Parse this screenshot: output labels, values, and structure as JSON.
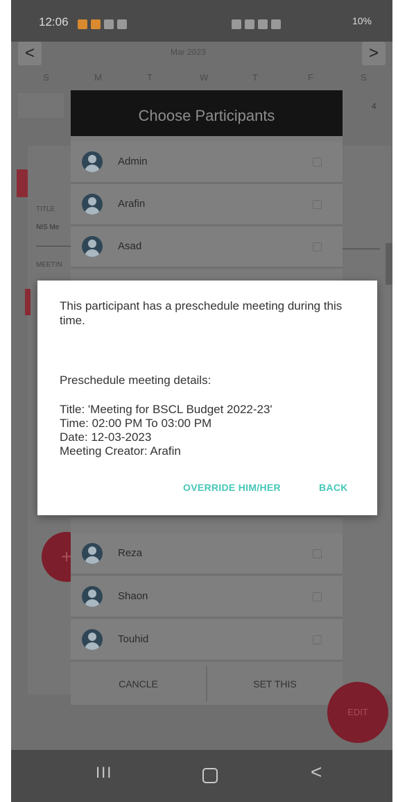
{
  "status_bar": {
    "time": "12:06",
    "right": "10%"
  },
  "calendar": {
    "month": "Mar 2023",
    "days": [
      "S",
      "M",
      "T",
      "W",
      "T",
      "F",
      "S"
    ],
    "prev": "<",
    "next": ">",
    "date_cell": "4",
    "fields": [
      "TITLE",
      "NIS Me",
      "MEETIN"
    ]
  },
  "participants_dialog": {
    "title": "Choose Participants",
    "top_participants": [
      "Admin",
      "Arafin",
      "Asad"
    ],
    "bottom_participants": [
      "Reza",
      "Shaon",
      "Touhid"
    ],
    "cancel_label": "CANCLE",
    "set_label": "SET THIS"
  },
  "fab_label": "EDIT",
  "alert": {
    "message": "This participant has a preschedule meeting during this time.",
    "details_heading": "Preschedule meeting details:",
    "title_line": "Title: 'Meeting for BSCL Budget 2022-23'",
    "time_line": "Time: 02:00 PM To 03:00 PM",
    "date_line": "Date: 12-03-2023",
    "creator_line": "Meeting Creator: Arafin",
    "override_label": "OVERRIDE HIM/HER",
    "back_label": "BACK"
  },
  "nav": {
    "recents": "III",
    "back": "<"
  }
}
